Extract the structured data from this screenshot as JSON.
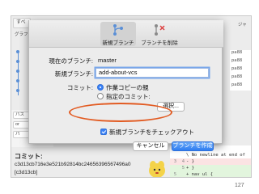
{
  "background_app": {
    "tab_all": "すべ",
    "tab_graph": "グラフ",
    "tab_right": "ジャ",
    "hashes": [
      "pa88",
      "pa88",
      "pa88",
      "pa88",
      "pa88"
    ],
    "path_label": "パス",
    "path_label2": "パ",
    "branch_pill": "or",
    "file_pill": "",
    "commit_label": "コミット:",
    "commit_hash": "c3d13cb716e3e521b92814bc24656396567496a0",
    "commit_hash2": "[c3d13cb]",
    "code_lines": [
      {
        "ln": "",
        "ln2": "",
        "text": "  teri"
      },
      {
        "ln": "",
        "ln2": "",
        "text": "\\ No newline at end of"
      },
      {
        "ln": "3",
        "ln2": "4",
        "text": "- }"
      },
      {
        "ln": "",
        "ln2": "5",
        "text": "+ }"
      },
      {
        "ln": "5",
        "ln2": "",
        "text": "+ nav ul {"
      }
    ]
  },
  "dialog": {
    "toolbar": {
      "new_branch_label": "新規ブランチ",
      "delete_branch_label": "ブランチを削除"
    },
    "current_branch_label": "現在のブランチ:",
    "current_branch_value": "master",
    "new_branch_label": "新規ブランチ:",
    "new_branch_value": "add-about-vcs",
    "commit_label": "コミット:",
    "radio_working_copy": "作業コピーの親",
    "radio_specified": "指定のコミット:",
    "select_button": "選択...",
    "checkout_checkbox": "新規ブランチをチェックアウト",
    "cancel_button": "キャンセル",
    "create_button": "ブランチを作成"
  },
  "colors": {
    "accent": "#3b82f6",
    "highlight": "#e25b22"
  },
  "page_number": "127"
}
